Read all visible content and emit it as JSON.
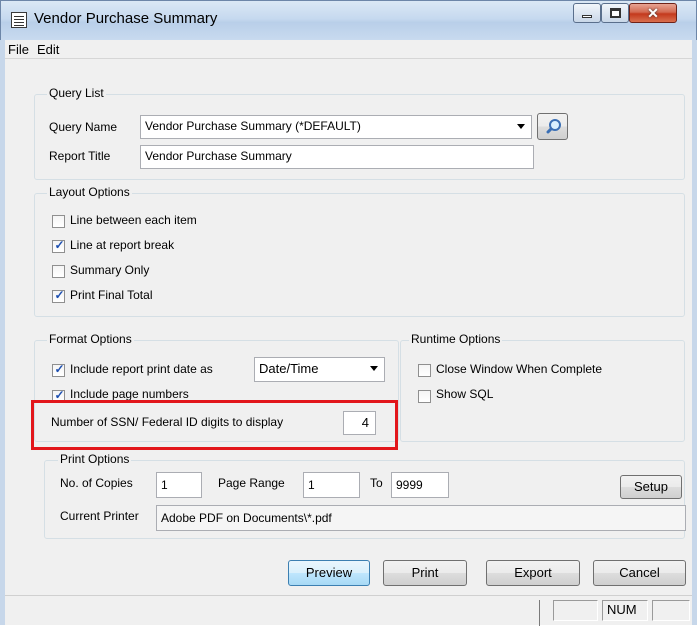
{
  "window": {
    "title": "Vendor Purchase Summary"
  },
  "menu": {
    "items": [
      "File",
      "Edit"
    ]
  },
  "query_list": {
    "legend": "Query List",
    "query_name_label": "Query Name",
    "query_name_value": "Vendor Purchase Summary (*DEFAULT)",
    "report_title_label": "Report Title",
    "report_title_value": "Vendor Purchase Summary"
  },
  "layout_options": {
    "legend": "Layout Options",
    "items": [
      {
        "label": "Line between each item",
        "checked": false
      },
      {
        "label": "Line at report break",
        "checked": true
      },
      {
        "label": "Summary Only",
        "checked": false
      },
      {
        "label": "Print Final Total",
        "checked": true
      }
    ]
  },
  "format_options": {
    "legend": "Format Options",
    "print_date_label": "Include report print date as",
    "print_date_value": "Date/Time",
    "page_numbers_label": "Include page numbers",
    "page_numbers_checked": true,
    "ssn_label": "Number of SSN/ Federal ID digits to display",
    "ssn_value": "4"
  },
  "runtime_options": {
    "legend": "Runtime Options",
    "close_window_label": "Close Window When Complete",
    "close_window_checked": false,
    "show_sql_label": "Show SQL",
    "show_sql_checked": false
  },
  "print_options": {
    "legend": "Print Options",
    "copies_label": "No. of Copies",
    "copies_value": "1",
    "page_range_label": "Page Range",
    "page_from": "1",
    "to_label": "To",
    "page_to": "9999",
    "setup_label": "Setup",
    "current_printer_label": "Current Printer",
    "current_printer_value": "Adobe PDF on Documents\\*.pdf"
  },
  "buttons": {
    "preview": "Preview",
    "print": "Print",
    "export": "Export",
    "cancel": "Cancel"
  },
  "status": {
    "num": "NUM"
  },
  "colors": {
    "highlight": "#e2161b",
    "check": "#1d4fb0"
  }
}
